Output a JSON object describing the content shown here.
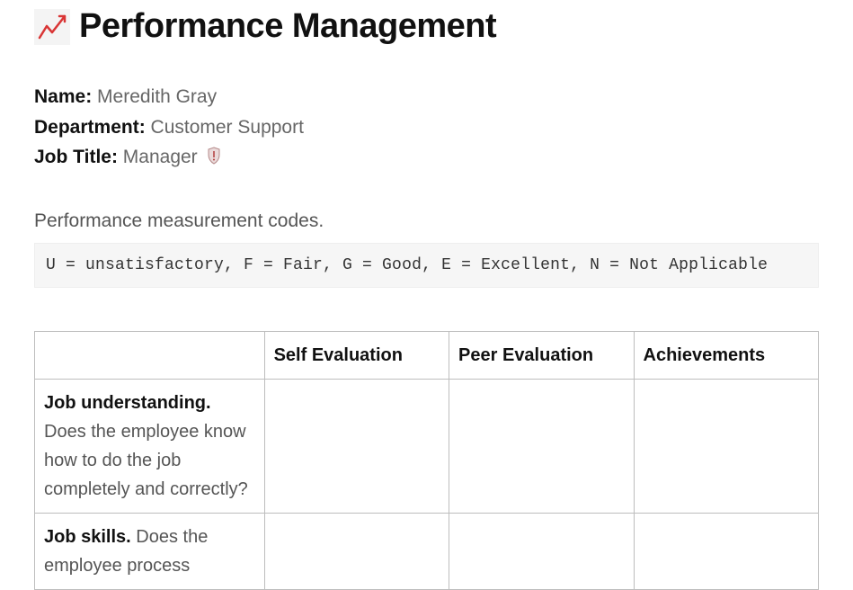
{
  "header": {
    "icon": "chart-increasing-icon",
    "title": "Performance Management"
  },
  "employee": {
    "name_label": "Name:",
    "name_value": "Meredith Gray",
    "department_label": "Department:",
    "department_value": "Customer Support",
    "job_title_label": "Job Title:",
    "job_title_value": "Manager",
    "badge_icon": "shield-icon"
  },
  "codes": {
    "intro": "Performance measurement codes.",
    "legend": "U = unsatisfactory, F = Fair, G = Good, E = Excellent, N = Not Applicable"
  },
  "table": {
    "headers": {
      "criteria": "",
      "self": "Self Evaluation",
      "peer": "Peer Evaluation",
      "achievements": "Achievements"
    },
    "rows": [
      {
        "title": "Job understanding.",
        "text": " Does the employee know how to do the job completely and correctly?",
        "self": "",
        "peer": "",
        "achievements": ""
      },
      {
        "title": "Job skills.",
        "text": " Does the employee process",
        "self": "",
        "peer": "",
        "achievements": ""
      }
    ]
  }
}
